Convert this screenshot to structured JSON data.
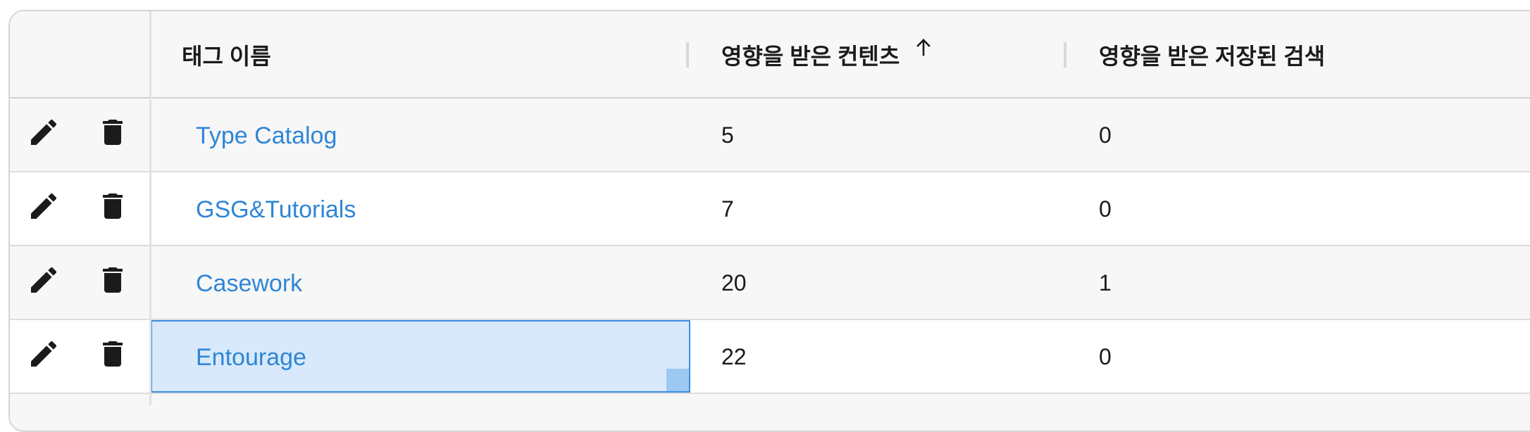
{
  "columns": {
    "tag_name": "태그 이름",
    "affected_content": "영향을 받은 컨텐츠",
    "affected_saved_searches": "영향을 받은 저장된 검색"
  },
  "sort": {
    "column": "affected_content",
    "direction": "ascending",
    "icon": "arrow-up-icon"
  },
  "icons": {
    "edit": "pencil-icon",
    "delete": "trash-icon"
  },
  "colors": {
    "link": "#2f86d6",
    "selection_fill": "#d8e9fb",
    "selection_border": "#3c8ee0"
  },
  "rows": [
    {
      "tag": "Type Catalog",
      "affected_content": "5",
      "affected_saved_searches": "0"
    },
    {
      "tag": "GSG&Tutorials",
      "affected_content": "7",
      "affected_saved_searches": "0"
    },
    {
      "tag": "Casework",
      "affected_content": "20",
      "affected_saved_searches": "1"
    },
    {
      "tag": "Entourage",
      "affected_content": "22",
      "affected_saved_searches": "0",
      "selected": true
    }
  ]
}
